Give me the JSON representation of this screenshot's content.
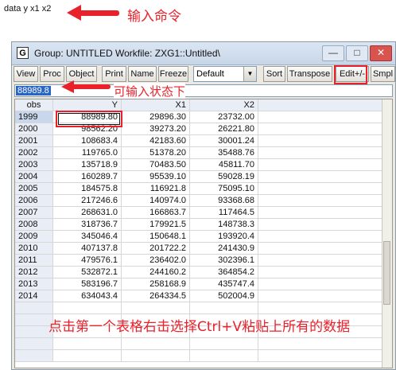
{
  "command": {
    "text": "data y x1 x2"
  },
  "annotations": {
    "command_note": "输入命令",
    "edit_note": "可输入状态下",
    "paste_note": "点击第一个表格右击选择Ctrl+V粘贴上所有的数据"
  },
  "window": {
    "icon_letter": "G",
    "title": "Group: UNTITLED   Workfile: ZXG1::Untitled\\",
    "controls": [
      "—",
      "□",
      "✕"
    ]
  },
  "toolbar": {
    "view": "View",
    "proc": "Proc",
    "object": "Object",
    "print": "Print",
    "name": "Name",
    "freeze": "Freeze",
    "select_value": "Default",
    "sort": "Sort",
    "transpose": "Transpose",
    "edit": "Edit+/-",
    "smpl": "Smpl"
  },
  "editbar": {
    "value": "88989.8"
  },
  "table": {
    "headers": [
      "obs",
      "Y",
      "X1",
      "X2"
    ],
    "rows": [
      [
        "1999",
        "88989.80",
        "29896.30",
        "23732.00"
      ],
      [
        "2000",
        "98562.20",
        "39273.20",
        "26221.80"
      ],
      [
        "2001",
        "108683.4",
        "42183.60",
        "30001.24"
      ],
      [
        "2002",
        "119765.0",
        "51378.20",
        "35488.76"
      ],
      [
        "2003",
        "135718.9",
        "70483.50",
        "45811.70"
      ],
      [
        "2004",
        "160289.7",
        "95539.10",
        "59028.19"
      ],
      [
        "2005",
        "184575.8",
        "116921.8",
        "75095.10"
      ],
      [
        "2006",
        "217246.6",
        "140974.0",
        "93368.68"
      ],
      [
        "2007",
        "268631.0",
        "166863.7",
        "117464.5"
      ],
      [
        "2008",
        "318736.7",
        "179921.5",
        "148738.3"
      ],
      [
        "2009",
        "345046.4",
        "150648.1",
        "193920.4"
      ],
      [
        "2010",
        "407137.8",
        "201722.2",
        "241430.9"
      ],
      [
        "2011",
        "479576.1",
        "236402.0",
        "302396.1"
      ],
      [
        "2012",
        "532872.1",
        "244160.2",
        "364854.2"
      ],
      [
        "2013",
        "583196.7",
        "258168.9",
        "435747.4"
      ],
      [
        "2014",
        "634043.4",
        "264334.5",
        "502004.9"
      ]
    ]
  },
  "colors": {
    "annotation": "#e8212b",
    "selection": "#2a64c4"
  }
}
